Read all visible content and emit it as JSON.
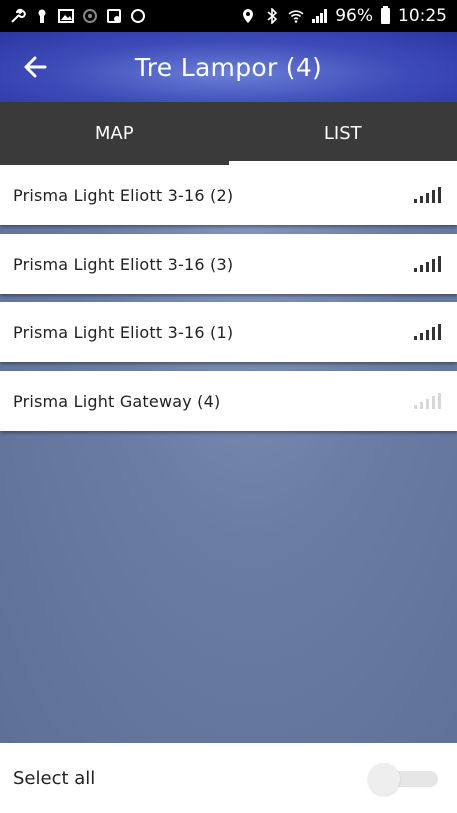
{
  "status_bar": {
    "left_icons": [
      "wrench-icon",
      "keyhole-icon",
      "image-icon",
      "target-icon",
      "cast-icon",
      "circle-icon"
    ],
    "right_icons": [
      "location-icon",
      "bluetooth-icon",
      "wifi-icon",
      "signal-icon"
    ],
    "battery": "96%",
    "time": "10:25"
  },
  "app_bar": {
    "back_icon": "arrow-left-icon",
    "title": "Tre Lampor (4)"
  },
  "tabs": [
    {
      "label": "MAP",
      "active": false
    },
    {
      "label": "LIST",
      "active": true
    }
  ],
  "devices": [
    {
      "name": "Prisma Light Eliott 3-16 (2)",
      "signal": "strong"
    },
    {
      "name": "Prisma Light Eliott 3-16 (3)",
      "signal": "strong"
    },
    {
      "name": "Prisma Light Eliott 3-16 (1)",
      "signal": "strong"
    },
    {
      "name": "Prisma Light Gateway (4)",
      "signal": "weak"
    }
  ],
  "footer": {
    "select_all_label": "Select all",
    "toggle_on": false
  },
  "colors": {
    "app_bar_accent": "#3d4bb8",
    "tab_bar": "#3a3a3a",
    "background": "#5f7298"
  }
}
